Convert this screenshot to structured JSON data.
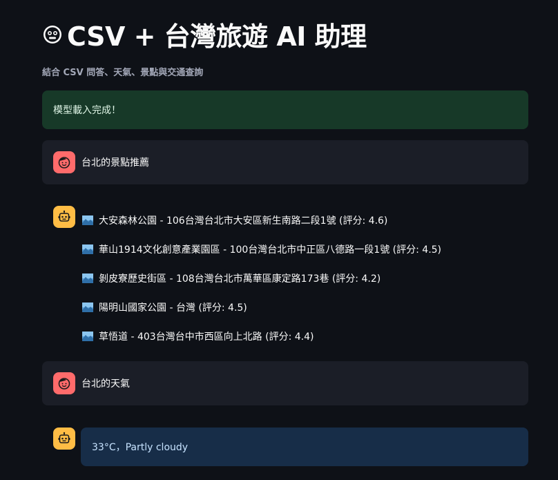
{
  "header": {
    "title": "CSV + 台灣旅遊 AI 助理",
    "subtitle": "結合 CSV 問答、天氣、景點與交通查詢"
  },
  "status": {
    "success_text": "模型載入完成！"
  },
  "chat": {
    "user_msg_1": "台北的景點推薦",
    "bot_recommendations": [
      {
        "text": "大安森林公園 - 106台灣台北市大安區新生南路二段1號 (評分: 4.6)"
      },
      {
        "text": "華山1914文化創意產業園區 - 100台灣台北市中正區八德路一段1號 (評分: 4.5)"
      },
      {
        "text": "剝皮寮歷史街區 - 108台灣台北市萬華區康定路173巷 (評分: 4.2)"
      },
      {
        "text": "陽明山國家公園 - 台灣 (評分: 4.5)"
      },
      {
        "text": "草悟道 - 403台灣台中市西區向上北路 (評分: 4.4)"
      }
    ],
    "user_msg_2": "台北的天氣",
    "bot_weather": "33°C，Partly cloudy"
  },
  "colors": {
    "background": "#0e1117",
    "success_bg": "#173928",
    "info_bg": "#172d48",
    "user_avatar": "#ff6b6b",
    "bot_avatar": "#ffbd45"
  },
  "icons": {
    "title": "face-icon",
    "user_avatar": "user-face-icon",
    "bot_avatar": "robot-icon",
    "list_item": "landscape-photo-icon"
  }
}
